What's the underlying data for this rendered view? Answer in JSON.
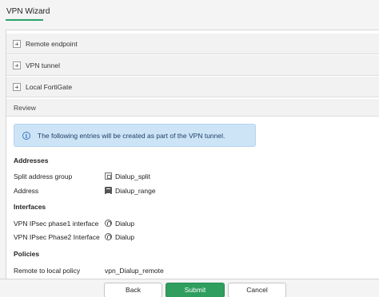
{
  "window": {
    "title": "VPN Wizard"
  },
  "sections": [
    {
      "label": "Remote endpoint"
    },
    {
      "label": "VPN tunnel"
    },
    {
      "label": "Local FortiGate"
    }
  ],
  "review": {
    "label": "Review",
    "info": "The following entries will be created as part of the VPN tunnel.",
    "addresses": {
      "title": "Addresses",
      "rows": [
        {
          "label": "Split address group",
          "value": "Dialup_split",
          "icon": "address-group-icon"
        },
        {
          "label": "Address",
          "value": "Dialup_range",
          "icon": "address-icon"
        }
      ]
    },
    "interfaces": {
      "title": "Interfaces",
      "rows": [
        {
          "label": "VPN IPsec phase1 interface",
          "value": "Dialup",
          "icon": "interface-icon"
        },
        {
          "label": "VPN IPsec Phase2 Interface",
          "value": "Dialup",
          "icon": "interface-icon"
        }
      ]
    },
    "policies": {
      "title": "Policies",
      "rows": [
        {
          "label": "Remote to local policy",
          "value": "vpn_Dialup_remote"
        }
      ]
    }
  },
  "footer": {
    "back_label": "Back",
    "submit_label": "Submit",
    "cancel_label": "Cancel"
  },
  "colors": {
    "accent": "#2aa36b",
    "primary_button": "#2f9e5f",
    "info_background": "#cde4f7"
  }
}
